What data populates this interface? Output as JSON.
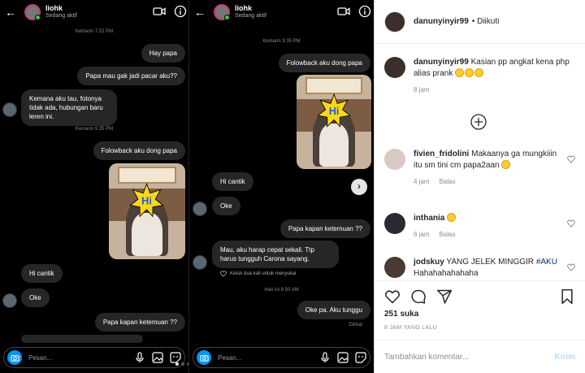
{
  "chat": {
    "username": "liohk",
    "status": "Sedang aktif",
    "composer_placeholder": "Pesan...",
    "panel1": {
      "ts1": "Kemarin 7.52 PM",
      "msg_hay": "Hay papa",
      "msg_mau": "Papa mau gak jadi pacar aku??",
      "msg_reply": "Kemana aku tau, fotonya tidak ada, hubungan baru leren ini.",
      "ts2": "Kemarin 9.35 PM",
      "msg_folow": "Folowback aku dong papa",
      "sticker_text": "Hi",
      "msg_hicantik": "Hi cantik",
      "msg_oke": "Oke",
      "msg_kapan": "Papa kapan ketemuan ??"
    },
    "panel2": {
      "ts1": "Kemarin 9.35 PM",
      "msg_folow": "Folowback aku dong papa",
      "sticker_text": "Hi",
      "msg_hicantik": "Hi cantik",
      "msg_oke": "Oke",
      "msg_kapan": "Papa kapan ketemuan ??",
      "msg_mau": "Mau, aku harap cepat sekali. Ttp harus tungguh Carona sayang.",
      "like_hint": "Ketuk dua kali untuk menyukai",
      "ts2": "Hari ini 8.50 AM",
      "msg_okepa": "Oke pa. Aku tunggu",
      "seen": "Dilihat"
    }
  },
  "post": {
    "username": "danunyinyir99",
    "follow_label": "• Diikuti",
    "caption_user": "danunyinyir99",
    "caption_text": "Kasian pp angkat kena php alias prank",
    "caption_time": "8 jam",
    "reply_label": "Balas",
    "comments": [
      {
        "user": "fivien_fridolini",
        "text": "Makaanya ga mungkiiin itu sm tini cm papa2aan",
        "time": "4 jam"
      },
      {
        "user": "inthania",
        "text": "",
        "time": "6 jam"
      },
      {
        "user": "jodskuy",
        "text": "YANG JELEK MINGGIR",
        "hashtag": "#AKU",
        "text2": "Hahahahahahaha",
        "time": ""
      }
    ],
    "likes": "251 suka",
    "posted_time": "8 JAM YANG LALU",
    "add_comment_placeholder": "Tambahkan komentar...",
    "post_button": "Kirim"
  },
  "colors": {
    "accent": "#0095f6",
    "chat_bg": "#000000",
    "bubble": "#262626"
  }
}
